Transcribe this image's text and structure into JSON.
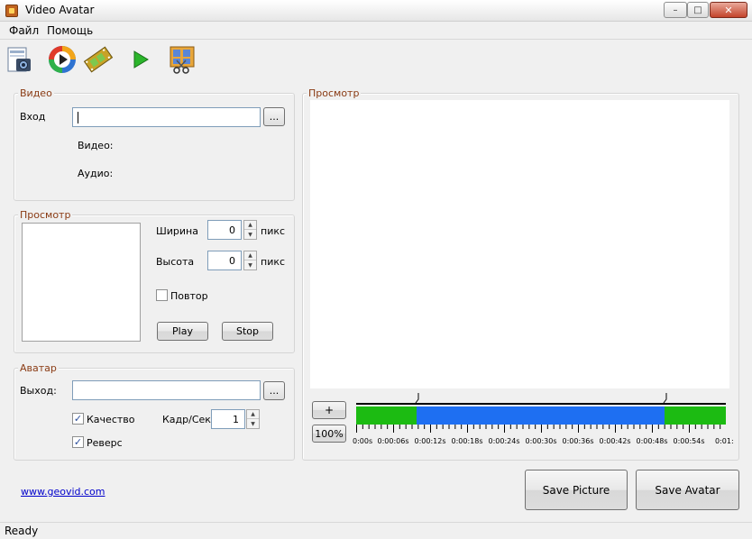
{
  "window": {
    "title": "Video Avatar",
    "minimize": "–",
    "maximize": "□",
    "close": "✕"
  },
  "menu": [
    {
      "label": "Файл"
    },
    {
      "label": "Помощь"
    }
  ],
  "toolbar": {
    "buttons": [
      {
        "name": "open-video-icon"
      },
      {
        "name": "media-player-icon"
      },
      {
        "name": "film-strip-icon"
      },
      {
        "name": "play-icon"
      },
      {
        "name": "edit-frames-icon"
      }
    ]
  },
  "video_group": {
    "title": "Видео",
    "input_label": "Вход",
    "input_value": "",
    "browse_label": "...",
    "video_info_label": "Видео:",
    "audio_info_label": "Аудио:"
  },
  "preview_group": {
    "title": "Просмотр",
    "width_label": "Ширина",
    "width_value": "0",
    "width_unit": "пикс",
    "height_label": "Высота",
    "height_value": "0",
    "height_unit": "пикс",
    "repeat_label": "Повтор",
    "repeat_checked": false,
    "play_label": "Play",
    "stop_label": "Stop"
  },
  "avatar_group": {
    "title": "Аватар",
    "output_label": "Выход:",
    "output_value": "",
    "browse_label": "...",
    "quality_label": "Качество",
    "quality_checked": true,
    "fps_label": "Кадр/Сек",
    "fps_value": "1",
    "reverse_label": "Реверс",
    "reverse_checked": true
  },
  "main_preview": {
    "title": "Просмотр",
    "zoom_in_label": "+",
    "zoom_label": "100%"
  },
  "timeline": {
    "ticks": [
      "0:00s",
      "0:00:06s",
      "0:00:12s",
      "0:00:18s",
      "0:00:24s",
      "0:00:30s",
      "0:00:36s",
      "0:00:42s",
      "0:00:48s",
      "0:00:54s",
      "0:01:"
    ],
    "selection_start_fraction": 0.163,
    "selection_end_fraction": 0.834,
    "selection_color": "#1e6ff2",
    "unselected_color": "#1cbb12"
  },
  "footer": {
    "link": "www.geovid.com",
    "save_picture_label": "Save Picture",
    "save_avatar_label": "Save Avatar"
  },
  "status": {
    "text": "Ready"
  }
}
